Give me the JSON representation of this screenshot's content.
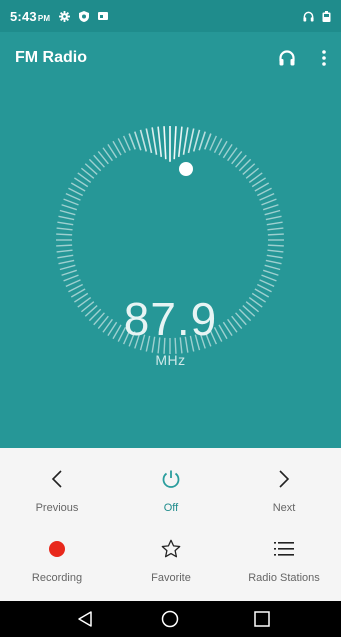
{
  "status_bar": {
    "time": "5:43",
    "ampm": "PM",
    "icons": [
      "settings-icon",
      "shield-icon",
      "card-icon"
    ],
    "right_icons": [
      "headset-status-icon",
      "battery-icon"
    ]
  },
  "app_bar": {
    "title": "FM Radio",
    "actions": [
      "headphones-icon",
      "more-vert-icon"
    ]
  },
  "tuner": {
    "frequency": "87.9",
    "unit": "MHz"
  },
  "controls": {
    "previous_label": "Previous",
    "power_label": "Off",
    "next_label": "Next",
    "recording_label": "Recording",
    "favorite_label": "Favorite",
    "stations_label": "Radio Stations"
  },
  "colors": {
    "teal": "#269797",
    "status_teal": "#1f8c8c",
    "record_red": "#e8281c",
    "controls_bg": "#f5f5f5"
  },
  "nav_bar": {
    "buttons": [
      "back-icon",
      "home-icon",
      "recents-icon"
    ]
  }
}
